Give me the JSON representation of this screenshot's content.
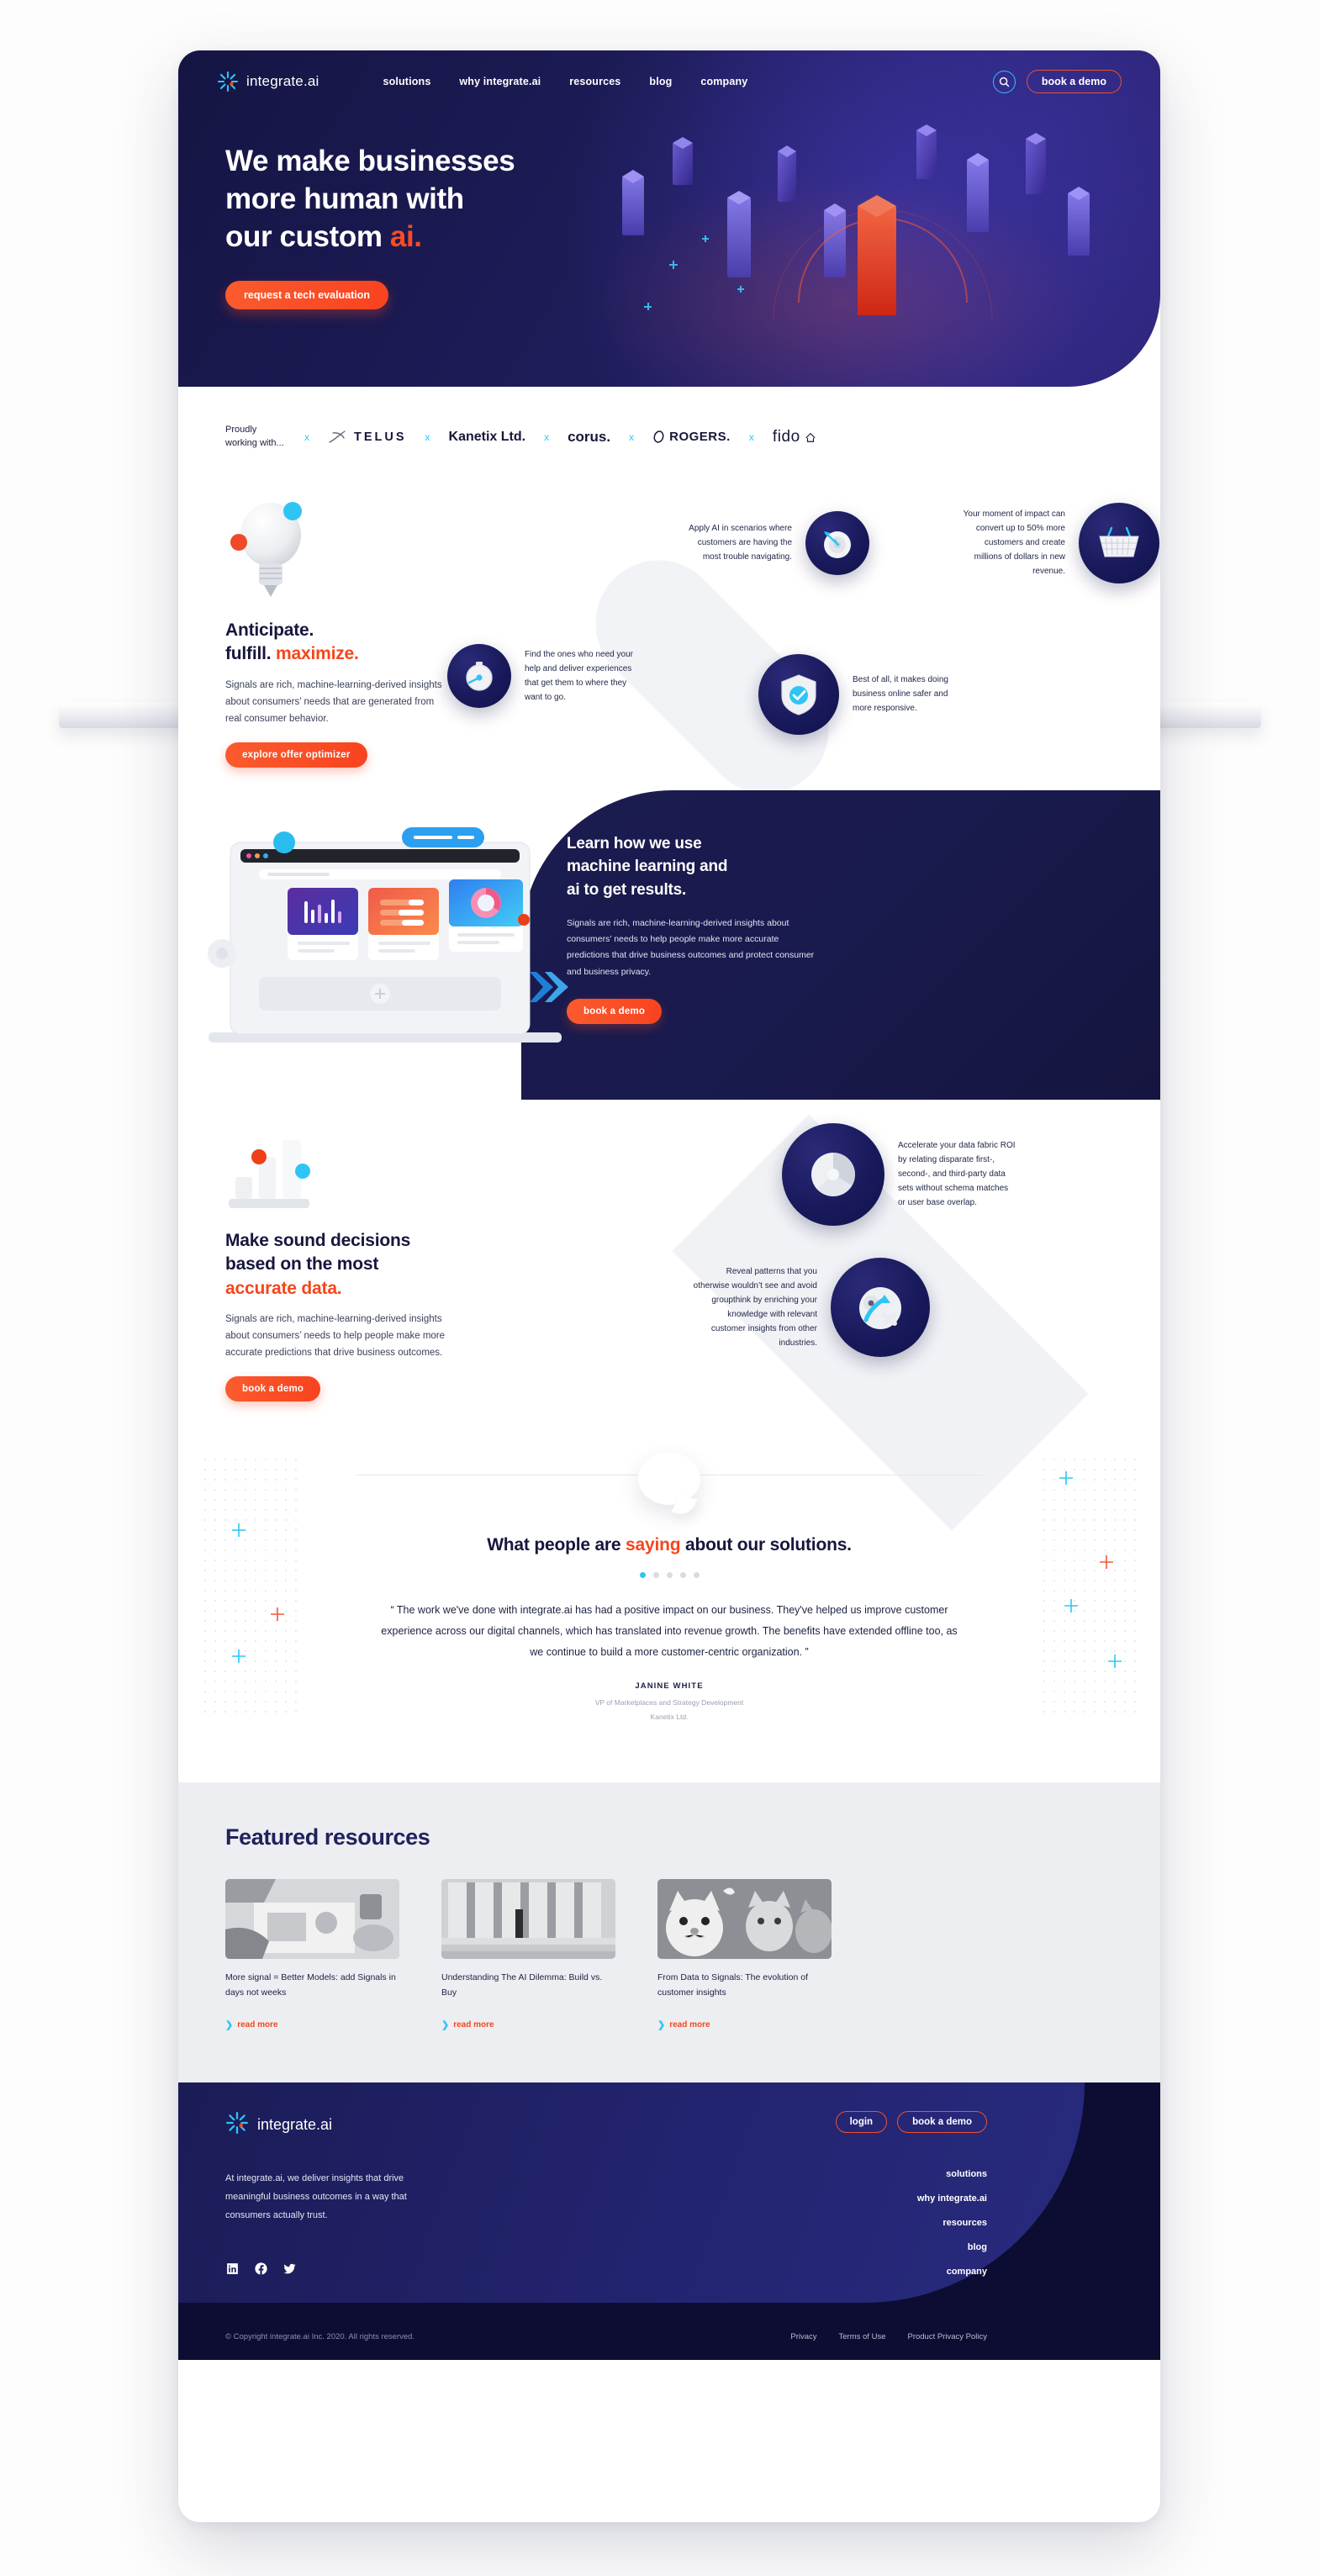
{
  "brand": {
    "name": "integrate.ai",
    "logo_icon": "starburst-icon"
  },
  "nav": {
    "links": [
      "solutions",
      "why integrate.ai",
      "resources",
      "blog",
      "company"
    ],
    "search_icon": "search-icon",
    "demo_label": "book a demo"
  },
  "hero": {
    "line1": "We make businesses",
    "line2": "more human with",
    "line3_plain": "our custom ",
    "line3_accent": "ai.",
    "cta": "request a tech evaluation"
  },
  "logos": {
    "label": "Proudly working with...",
    "separator": "x",
    "items": [
      "TELUS",
      "Kanetix Ltd.",
      "corus.",
      "ROGERS.",
      "fido"
    ]
  },
  "anticipate": {
    "icon": "lightbulb-icon",
    "title_line1": "Anticipate.",
    "title_line2_plain": "fulfill. ",
    "title_line2_accent": "maximize.",
    "body": "Signals are rich, machine-learning-derived insights about consumers’ needs that are generated from real consumer behavior.",
    "cta": "explore offer optimizer",
    "features": [
      {
        "text": "Apply AI in scenarios where customers are having the most trouble navigating.",
        "icon": "target-dart-icon"
      },
      {
        "text": "Your moment of impact can convert up to 50% more customers and create millions of dollars in new revenue.",
        "icon": "shopping-basket-icon"
      },
      {
        "text": "Find the ones who need your help and deliver experiences that get them to where they want to go.",
        "icon": "stopwatch-icon"
      },
      {
        "text": "Best of all, it makes doing business online safer and more responsive.",
        "icon": "shield-check-icon"
      }
    ]
  },
  "ml": {
    "title_l1": "Learn how we use",
    "title_l2": "machine learning and",
    "title_l3": "ai to get results.",
    "body": "Signals are rich, machine-learning-derived insights about consumers’ needs to help people make more accurate predictions that drive business outcomes and protect consumer and business privacy.",
    "cta": "book a demo",
    "illustration": "laptop-dashboard-icon"
  },
  "sound": {
    "icon": "bar-chart-icon",
    "title_l1": "Make sound decisions",
    "title_l2": "based on the most",
    "title_l3_accent": "accurate data.",
    "body": "Signals are rich, machine-learning-derived insights about consumers’ needs to help people make more accurate predictions that drive business outcomes.",
    "cta": "book a demo",
    "features": [
      {
        "text": "Accelerate your data fabric ROI by relating disparate first-, second-, and third-party data sets without schema matches or user base overlap.",
        "icon": "pie-chart-icon"
      },
      {
        "text": "Reveal patterns that you otherwise wouldn’t see and avoid groupthink by enriching your knowledge with relevant customer insights from other industries.",
        "icon": "arrow-pin-icon"
      }
    ]
  },
  "testimonial": {
    "bubble_icon": "speech-bubble-icon",
    "heading_pre": "What people are ",
    "heading_accent": "saying",
    "heading_post": " about our solutions.",
    "dots": 5,
    "active_dot": 0,
    "quote": "“ The work we've done with integrate.ai has had a positive impact on our business. They've helped us improve customer experience across our digital channels, which has translated into revenue growth. The benefits have extended offline too, as we continue to build a more customer-centric organization. ”",
    "author": "JANINE WHITE",
    "role": "VP of Marketplaces and Strategy Development",
    "company": "Kanetix Ltd."
  },
  "resources": {
    "heading": "Featured resources",
    "cards": [
      {
        "title": "More signal = Better Models: add Signals in days not weeks",
        "link": "read more",
        "image": "team-meeting-photo"
      },
      {
        "title": "Understanding The AI Dilemma: Build vs. Buy",
        "link": "read more",
        "image": "columns-building-photo"
      },
      {
        "title": "From Data to Signals: The evolution of customer insights",
        "link": "read more",
        "image": "cat-figurines-photo"
      }
    ]
  },
  "footer": {
    "logo_text": "integrate.ai",
    "login_label": "login",
    "demo_label": "book a demo",
    "about": "At integrate.ai, we deliver insights that drive meaningful business outcomes in a way that consumers actually trust.",
    "nav": [
      "solutions",
      "why integrate.ai",
      "resources",
      "blog",
      "company"
    ],
    "socials": [
      "linkedin-icon",
      "facebook-icon",
      "twitter-icon"
    ],
    "copyright": "© Copyright integrate.ai Inc. 2020. All rights reserved.",
    "legal": [
      "Privacy",
      "Terms of Use",
      "Product Privacy Policy"
    ]
  },
  "colors": {
    "navy": "#16163e",
    "deep": "#1b1b4f",
    "orange": "#f5461c",
    "cyan": "#2ec5f5",
    "grey_bg": "#eceef2"
  }
}
